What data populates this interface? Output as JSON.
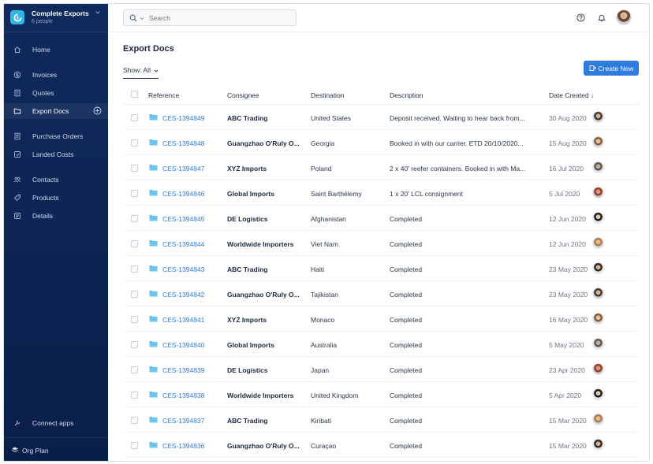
{
  "org": {
    "name": "Complete Exports",
    "subtitle": "6 people"
  },
  "nav": {
    "items": [
      {
        "label": "Home",
        "icon": "home-icon"
      },
      {
        "label": "Invoices",
        "icon": "invoice-icon"
      },
      {
        "label": "Quotes",
        "icon": "quote-icon"
      },
      {
        "label": "Export Docs",
        "icon": "folder-icon",
        "active": true
      },
      {
        "label": "Purchase Orders",
        "icon": "purchase-order-icon"
      },
      {
        "label": "Landed Costs",
        "icon": "landed-costs-icon"
      },
      {
        "label": "Contacts",
        "icon": "contacts-icon"
      },
      {
        "label": "Products",
        "icon": "tag-icon"
      },
      {
        "label": "Details",
        "icon": "details-icon"
      }
    ],
    "connect_apps": "Connect apps",
    "org_plan": "Org Plan"
  },
  "search": {
    "placeholder": "Search"
  },
  "page": {
    "title": "Export Docs",
    "filter_label": "Show: All",
    "create_button": "Create New"
  },
  "table": {
    "columns": [
      "Reference",
      "Consignee",
      "Destination",
      "Description",
      "Date Created ↓"
    ],
    "rows": [
      {
        "ref": "CES-1394849",
        "consignee": "ABC Trading",
        "destination": "United States",
        "description": "Deposit received. Waiting to hear back from...",
        "date": "30 Aug 2020"
      },
      {
        "ref": "CES-1394848",
        "consignee": "Guangzhao O'Ruly O...",
        "destination": "Georgia",
        "description": "Booked in with our carrier. ETD 20/10/2020...",
        "date": "15 Aug 2020"
      },
      {
        "ref": "CES-1394847",
        "consignee": "XYZ Imports",
        "destination": "Poland",
        "description": "2 x 40' reefer containers. Booked in with Ma...",
        "date": "16 Jul 2020"
      },
      {
        "ref": "CES-1394846",
        "consignee": "Global Imports",
        "destination": "Saint Barthélemy",
        "description": "1 x 20' LCL consignment",
        "date": "5 Jul 2020"
      },
      {
        "ref": "CES-1394845",
        "consignee": "DE Logistics",
        "destination": "Afghanistan",
        "description": "Completed",
        "date": "12 Jun 2020"
      },
      {
        "ref": "CES-1394844",
        "consignee": "Worldwide Importers",
        "destination": "Viet Nam",
        "description": "Completed",
        "date": "12 Jun 2020"
      },
      {
        "ref": "CES-1394843",
        "consignee": "ABC Trading",
        "destination": "Haiti",
        "description": "Completed",
        "date": "23 May 2020"
      },
      {
        "ref": "CES-1394842",
        "consignee": "Guangzhao O'Ruly O...",
        "destination": "Tajikistan",
        "description": "Completed",
        "date": "23 May 2020"
      },
      {
        "ref": "CES-1394841",
        "consignee": "XYZ Imports",
        "destination": "Monaco",
        "description": "Completed",
        "date": "16 May 2020"
      },
      {
        "ref": "CES-1394840",
        "consignee": "Global Imports",
        "destination": "Australia",
        "description": "Completed",
        "date": "5 May 2020"
      },
      {
        "ref": "CES-1394839",
        "consignee": "DE Logistics",
        "destination": "Japan",
        "description": "Completed",
        "date": "23 Apr 2020"
      },
      {
        "ref": "CES-1394838",
        "consignee": "Worldwide Importers",
        "destination": "United Kingdom",
        "description": "Completed",
        "date": "5 Apr 2020"
      },
      {
        "ref": "CES-1394837",
        "consignee": "ABC Trading",
        "destination": "Kiribati",
        "description": "Completed",
        "date": "15 Mar 2020"
      },
      {
        "ref": "CES-1394836",
        "consignee": "Guangzhao O'Ruly O...",
        "destination": "Curaçao",
        "description": "Completed",
        "date": "15 Mar 2020"
      }
    ]
  },
  "colors": {
    "sidebar_bg": "#0f2a5c",
    "accent": "#2f7be0",
    "brand_logo": "#2fb6e8",
    "folder": "#6cc4ef"
  }
}
